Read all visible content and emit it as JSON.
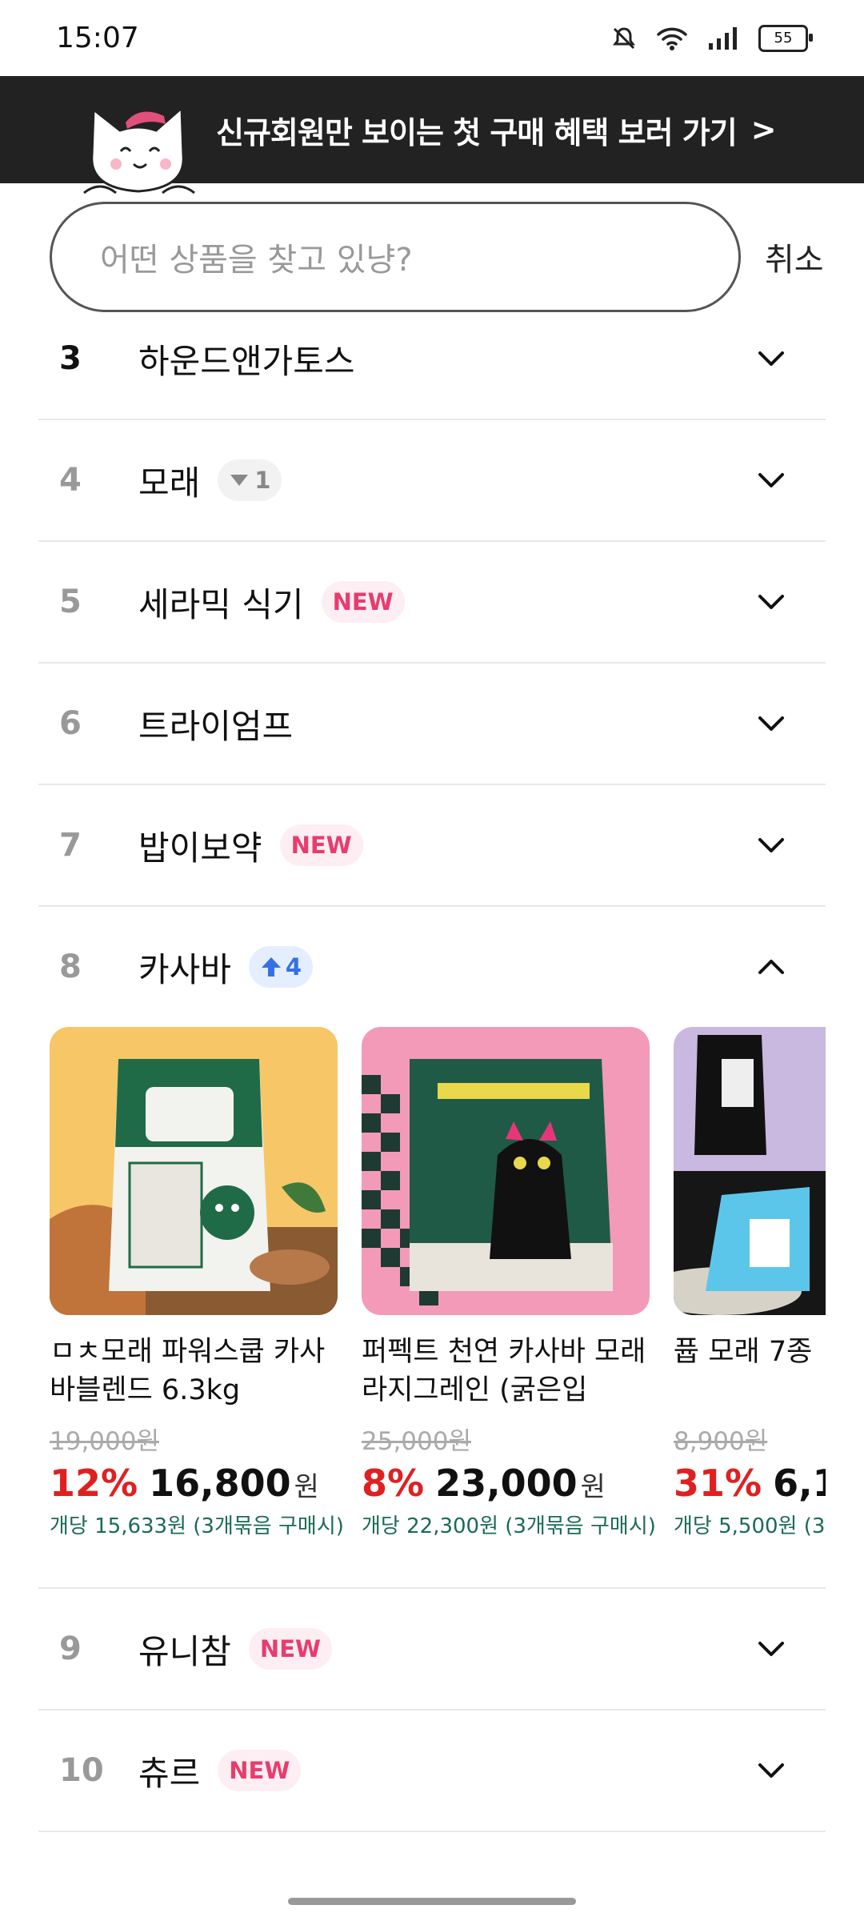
{
  "status_bar": {
    "time": "15:07",
    "battery": "55"
  },
  "promo": {
    "text": "신규회원만 보이는 첫 구매 혜택 보러 가기",
    "arrow": ">"
  },
  "search": {
    "placeholder": "어떤 상품을 찾고 있냥?",
    "cancel_label": "취소"
  },
  "rankings": [
    {
      "rank": "3",
      "name": "하운드앤가토스",
      "badge": null
    },
    {
      "rank": "4",
      "name": "모래",
      "badge": {
        "type": "down",
        "text": "1"
      }
    },
    {
      "rank": "5",
      "name": "세라믹 식기",
      "badge": {
        "type": "new",
        "text": "NEW"
      }
    },
    {
      "rank": "6",
      "name": "트라이엄프",
      "badge": null
    },
    {
      "rank": "7",
      "name": "밥이보약",
      "badge": {
        "type": "new",
        "text": "NEW"
      }
    }
  ],
  "expanded": {
    "rank": "8",
    "name": "카사바",
    "badge": {
      "type": "up",
      "text": "4"
    },
    "products": [
      {
        "title": "ㅁㅊ모래 파워스쿱 카사바블렌드 6.3kg",
        "original": "19,000원",
        "discount": "12%",
        "price": "16,800",
        "won": "원",
        "unit": "개당 15,633원 (3개묶음 구매시)"
      },
      {
        "title": "퍼펙트 천연 카사바 모래 라지그레인 (굵은입자)…",
        "original": "25,000원",
        "discount": "8%",
        "price": "23,000",
        "won": "원",
        "unit": "개당 22,300원 (3개묶음 구매시)"
      },
      {
        "title": "퓹 모래 7종",
        "original": "8,900원",
        "discount": "31%",
        "price": "6,1",
        "won": "",
        "unit": "개당 5,500원 (3."
      }
    ]
  },
  "rankings_after": [
    {
      "rank": "9",
      "name": "유니참",
      "badge": {
        "type": "new",
        "text": "NEW"
      }
    },
    {
      "rank": "10",
      "name": "츄르",
      "badge": {
        "type": "new",
        "text": "NEW"
      }
    }
  ],
  "colors": {
    "accent_red": "#e02020",
    "new_pink": "#e83c6e",
    "up_blue": "#3570e6",
    "unit_green": "#1a6b55",
    "banner_bg": "#222222"
  }
}
